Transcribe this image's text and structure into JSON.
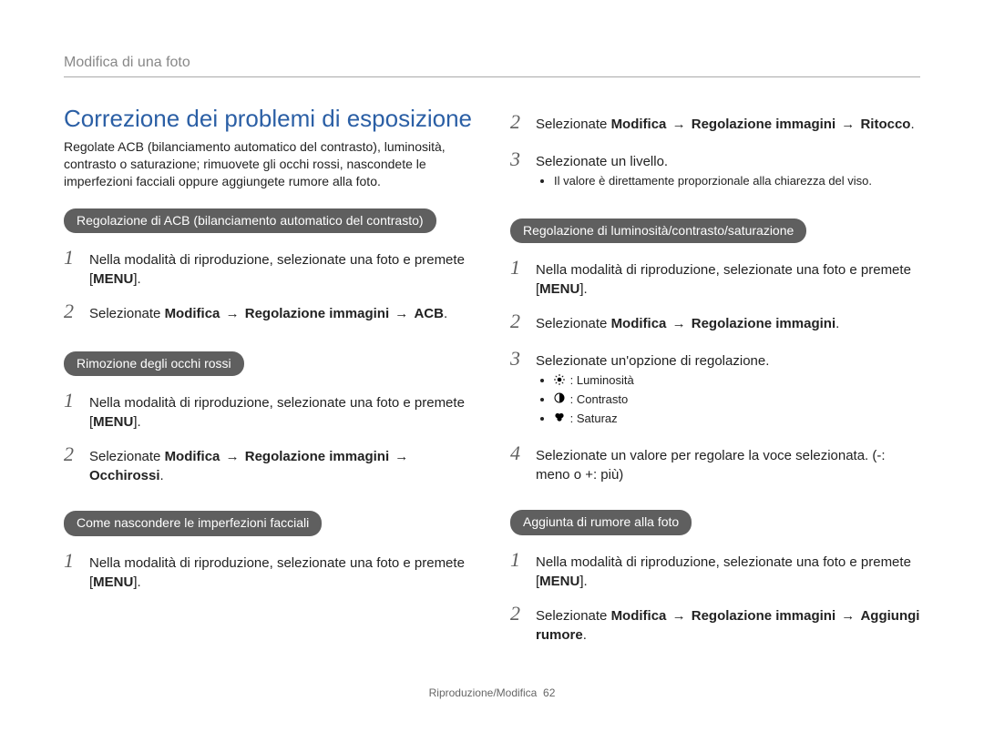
{
  "breadcrumb": "Modifica di una foto",
  "section_title": "Correzione dei problemi di esposizione",
  "intro": "Regolate ACB (bilanciamento automatico del contrasto), luminosità, contrasto o saturazione; rimuovete gli occhi rossi, nascondete le imperfezioni facciali oppure aggiungete rumore alla foto.",
  "menu_label": "MENU",
  "arrow": " → ",
  "acb": {
    "pill": "Regolazione di ACB (bilanciamento automatico del contrasto)",
    "step1_a": "Nella modalità di riproduzione, selezionate una foto e premete [",
    "step1_b": "].",
    "step2_a": "Selezionate ",
    "step2_b": "Modifica",
    "step2_c": "Regolazione immagini",
    "step2_d": "ACB",
    "step2_e": "."
  },
  "redeye": {
    "pill": "Rimozione degli occhi rossi",
    "step1_a": "Nella modalità di riproduzione, selezionate una foto e premete [",
    "step1_b": "].",
    "step2_a": "Selezionate ",
    "step2_b": "Modifica",
    "step2_c": "Regolazione immagini",
    "step2_d": "Occhirossi",
    "step2_e": "."
  },
  "face": {
    "pill": "Come nascondere le imperfezioni facciali",
    "step1_a": "Nella modalità di riproduzione, selezionate una foto e premete [",
    "step1_b": "].",
    "step2_a": "Selezionate ",
    "step2_b": "Modifica",
    "step2_c": "Regolazione immagini",
    "step2_d": "Ritocco",
    "step2_e": ".",
    "step3": "Selezionate un livello.",
    "bullet1": "Il valore è direttamente proporzionale alla chiarezza del viso."
  },
  "bcs": {
    "pill": "Regolazione di luminosità/contrasto/saturazione",
    "step1_a": "Nella modalità di riproduzione, selezionate una foto e premete [",
    "step1_b": "].",
    "step2_a": "Selezionate ",
    "step2_b": "Modifica",
    "step2_c": "Regolazione immagini",
    "step2_d": ".",
    "step3": "Selezionate un'opzione di regolazione.",
    "opt1": ": Luminosità",
    "opt2": ": Contrasto",
    "opt3": ": Saturaz",
    "step4": "Selezionate un valore per regolare la voce selezionata. (-: meno o +: più)"
  },
  "noise": {
    "pill": "Aggiunta di rumore alla foto",
    "step1_a": "Nella modalità di riproduzione, selezionate una foto e premete [",
    "step1_b": "].",
    "step2_a": "Selezionate ",
    "step2_b": "Modifica",
    "step2_c": "Regolazione immagini",
    "step2_d": "Aggiungi rumore",
    "step2_e": "."
  },
  "footer": {
    "label": "Riproduzione/Modifica",
    "page": "62"
  }
}
